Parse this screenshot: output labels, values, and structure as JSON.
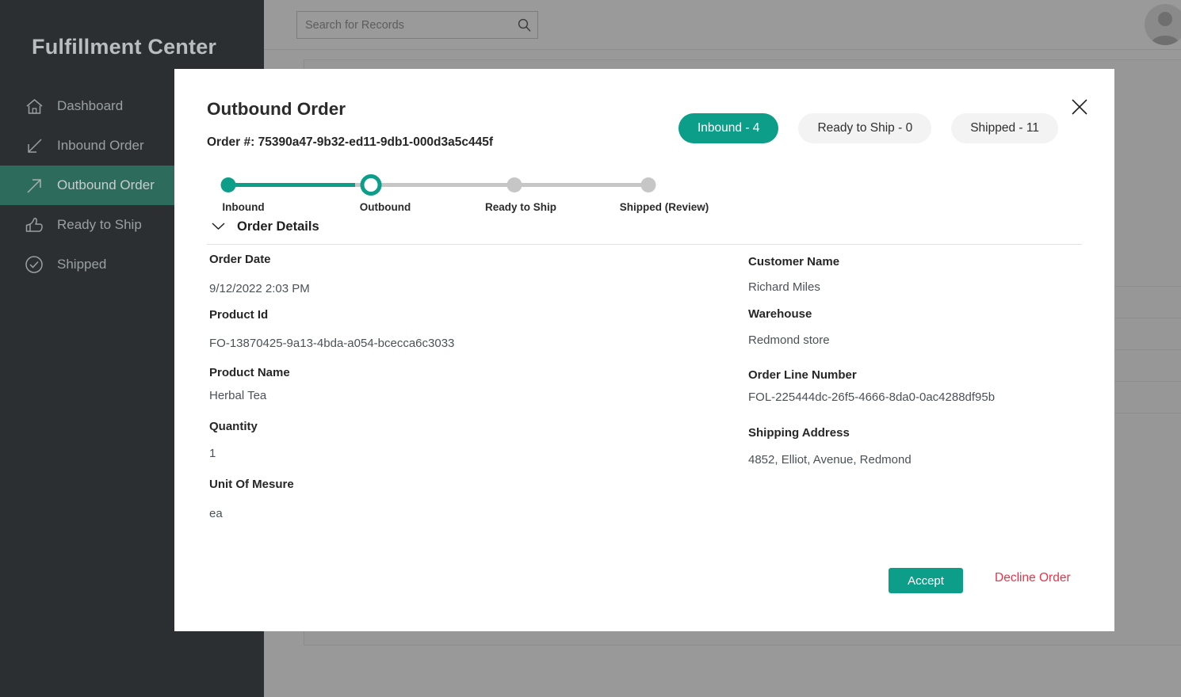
{
  "app": {
    "title": "Fulfillment Center",
    "accent_color": "#0d9e8a",
    "sidebar_bg": "#2b2f31",
    "sidebar_active_bg": "#2d6b5c",
    "danger_color": "#e8344a"
  },
  "sidebar": {
    "items": [
      {
        "label": "Dashboard",
        "icon": "home-icon",
        "active": false
      },
      {
        "label": "Inbound Order",
        "icon": "arrow-down-left-icon",
        "active": false
      },
      {
        "label": "Outbound Order",
        "icon": "arrow-up-right-icon",
        "active": true
      },
      {
        "label": "Ready to Ship",
        "icon": "thumbs-up-icon",
        "active": false
      },
      {
        "label": "Shipped",
        "icon": "check-circle-icon",
        "active": false
      }
    ]
  },
  "topbar": {
    "search": {
      "placeholder": "Search for Records",
      "value": "",
      "icon": "search-icon"
    },
    "avatar_icon": "user-avatar-icon"
  },
  "modal": {
    "title": "Outbound Order",
    "order_number_label": "Order #: 75390a47-9b32-ed11-9db1-000d3a5c445f",
    "close_icon": "close-icon",
    "pills": [
      {
        "label": "Inbound - 4",
        "active": true
      },
      {
        "label": "Ready to Ship - 0",
        "active": false
      },
      {
        "label": "Shipped - 11",
        "active": false
      }
    ],
    "stepper": {
      "steps": [
        {
          "label": "Inbound",
          "state": "done"
        },
        {
          "label": "Outbound",
          "state": "current"
        },
        {
          "label": "Ready to Ship",
          "state": "upcoming"
        },
        {
          "label": "Shipped (Review)",
          "state": "upcoming"
        }
      ]
    },
    "details": {
      "caption": "Order Details",
      "expanded": true,
      "chevron_icon": "chevron-down-icon",
      "left_fields": [
        {
          "label": "Order Date",
          "value": " 9/12/2022 2:03 PM"
        },
        {
          "label": "Product Id",
          "value": "FO-13870425-9a13-4bda-a054-bcecca6c3033"
        },
        {
          "label": "Product Name",
          "value": "Herbal Tea"
        },
        {
          "label": "Quantity",
          "value": "1"
        },
        {
          "label": "Unit Of Mesure",
          "value": "ea"
        }
      ],
      "right_fields": [
        {
          "label": "Customer Name",
          "value": " Richard Miles"
        },
        {
          "label": "Warehouse",
          "value": "Redmond store"
        },
        {
          "label": "Order Line Number",
          "value": "FOL-225444dc-26f5-4666-8da0-0ac4288df95b"
        },
        {
          "label": "Shipping Address",
          "value": "4852, Elliot, Avenue, Redmond"
        }
      ]
    },
    "actions": {
      "accept_label": "Accept",
      "decline_label": "Decline Order"
    }
  }
}
